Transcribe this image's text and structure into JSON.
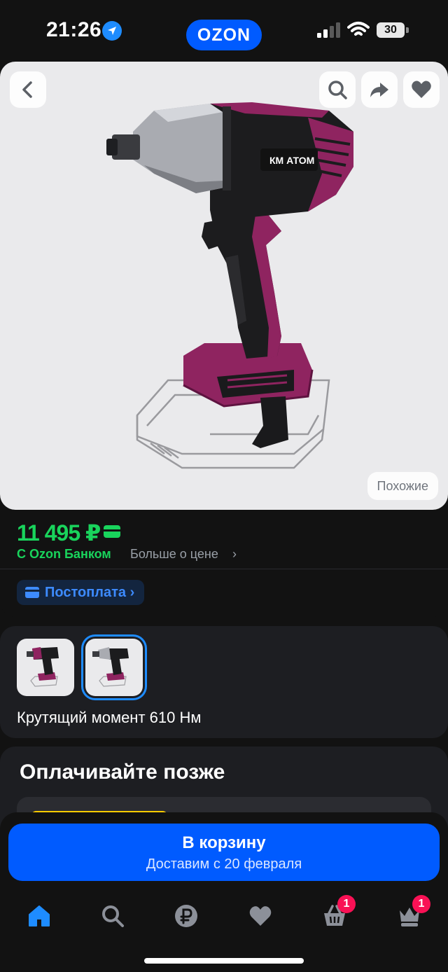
{
  "status_bar": {
    "time": "21:26",
    "brand": "OZON",
    "battery": "30",
    "icons": [
      "location-arrow-icon",
      "signal-icon",
      "wifi-icon",
      "battery-icon"
    ]
  },
  "product": {
    "image_label": "КМ АТОМ",
    "similar_label": "Похожие",
    "actions": [
      "back-icon",
      "search-icon",
      "share-icon",
      "heart-icon"
    ]
  },
  "price": {
    "amount": "11 495 ₽",
    "bank_label": "С Ozon Банком",
    "more_label": "Больше о цене",
    "chevron": "›",
    "accent": "#19d45c"
  },
  "postpay": {
    "label": "Постоплата ›",
    "color": "#3d8bff"
  },
  "variants": {
    "feature_text": "Крутящий момент 610 Нм",
    "selected_index": 1
  },
  "pay_later": {
    "title": "Оплачивайте позже"
  },
  "cart": {
    "title": "В корзину",
    "subtitle": "Доставим с 20 февраля",
    "color": "#005bff"
  },
  "bottom_nav": {
    "items": [
      {
        "icon": "home-icon",
        "active": true
      },
      {
        "icon": "search-icon",
        "active": false
      },
      {
        "icon": "ruble-icon",
        "active": false
      },
      {
        "icon": "heart-icon",
        "active": false
      },
      {
        "icon": "cart-icon",
        "badge": "1"
      },
      {
        "icon": "crown-icon",
        "badge": "1"
      }
    ],
    "active_color": "#1e8cff",
    "badge_color": "#f91155"
  }
}
